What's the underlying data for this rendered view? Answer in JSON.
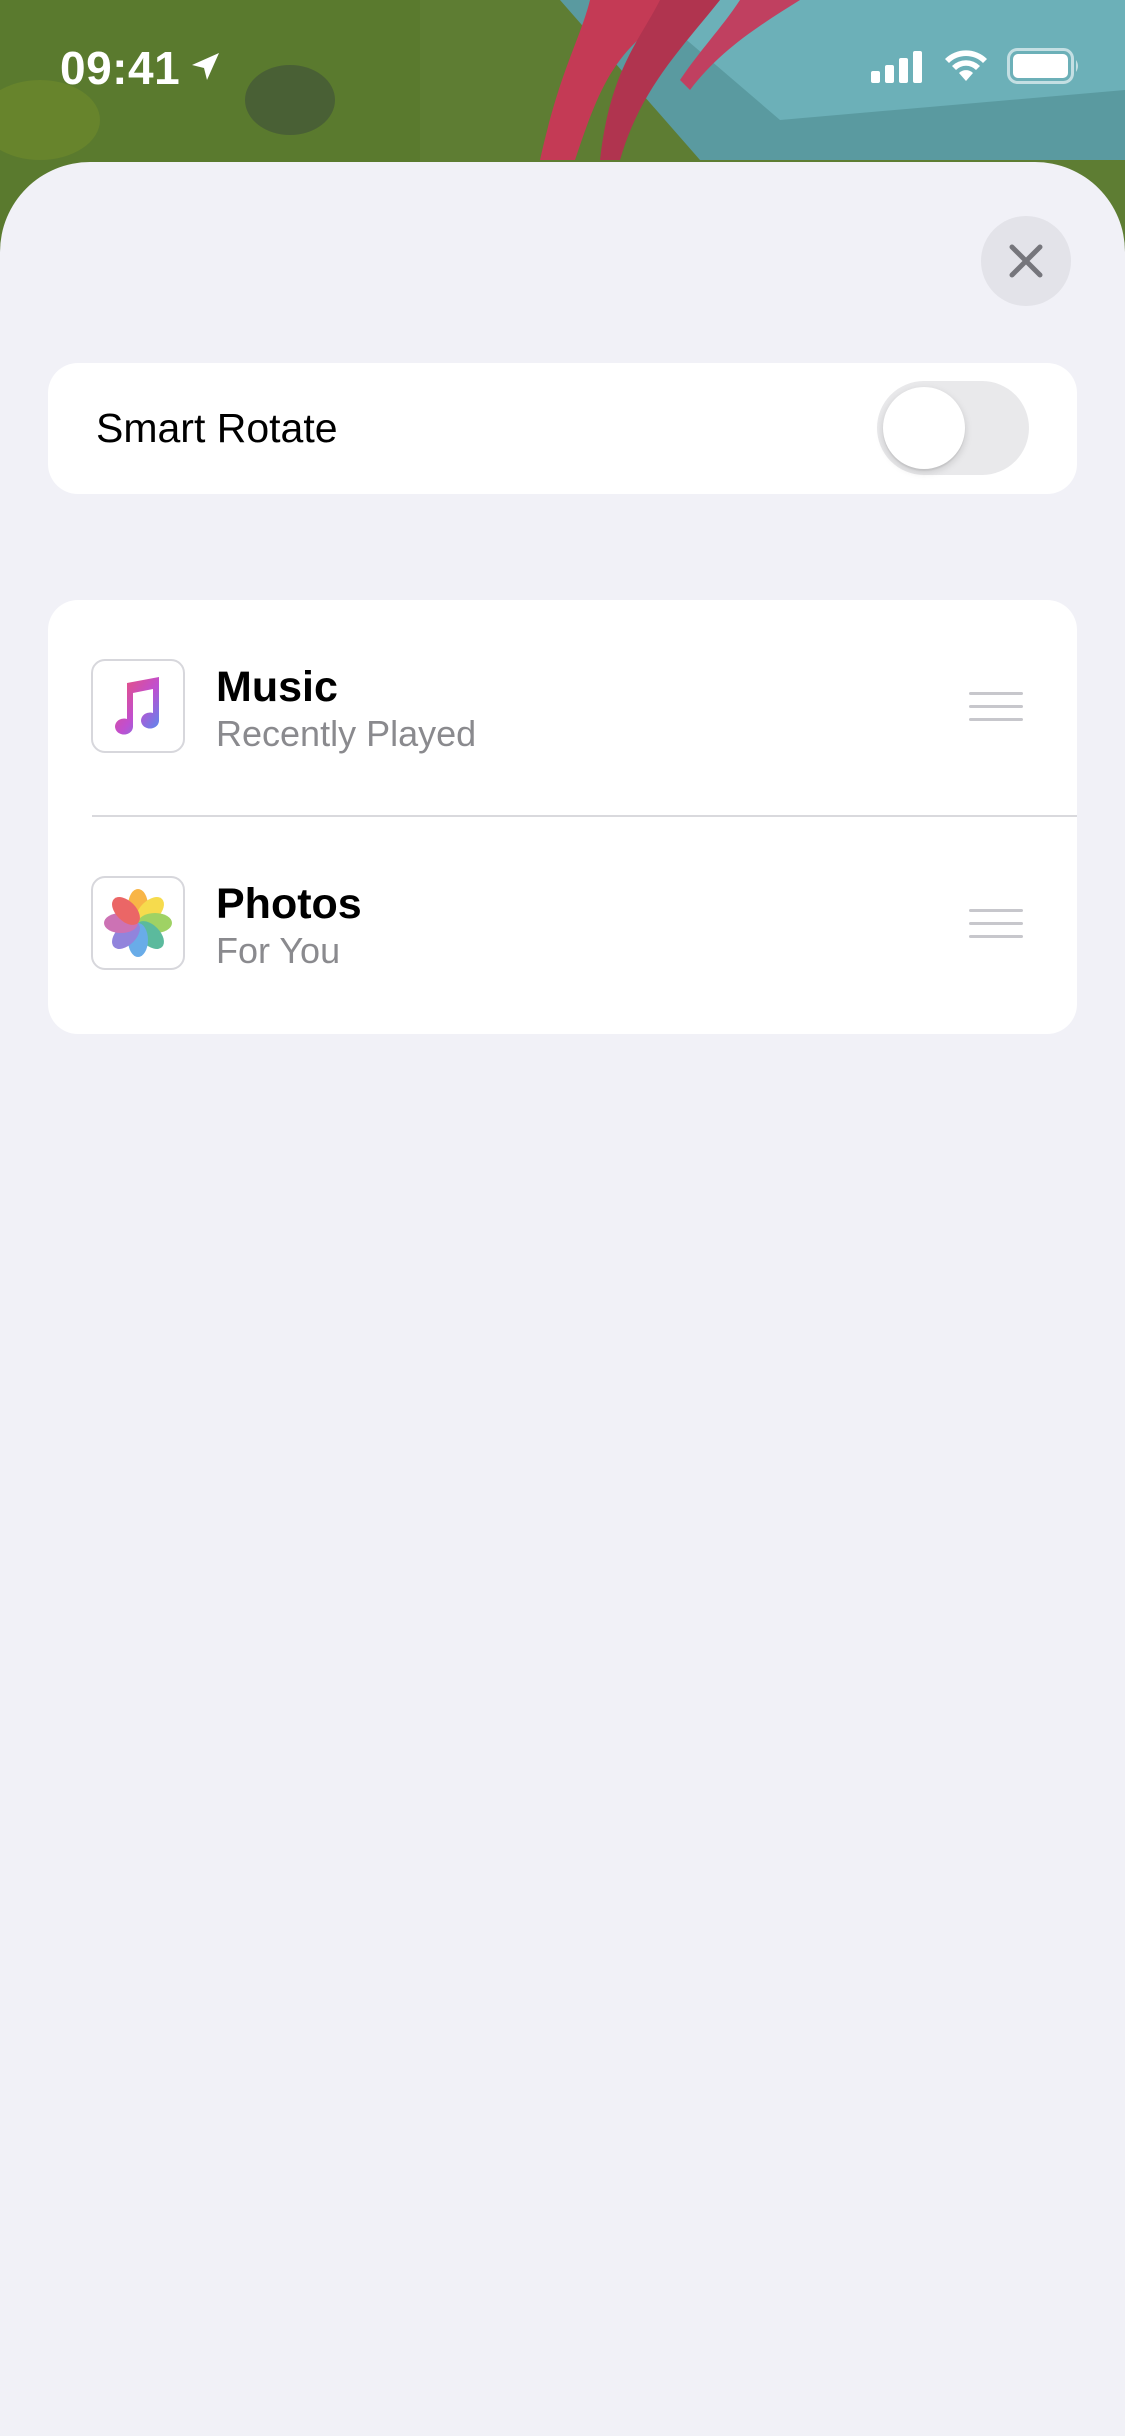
{
  "status_bar": {
    "time": "09:41",
    "icons": [
      "location-arrow-icon",
      "cellular-signal-icon",
      "wifi-icon",
      "battery-icon"
    ]
  },
  "sheet": {
    "close_icon": "close-icon"
  },
  "smart_rotate": {
    "label": "Smart Rotate",
    "enabled": false
  },
  "widgets": [
    {
      "app": "Music",
      "subtitle": "Recently Played",
      "icon": "music-app-icon"
    },
    {
      "app": "Photos",
      "subtitle": "For You",
      "icon": "photos-app-icon"
    }
  ],
  "colors": {
    "sheet_background": "#f1f1f7",
    "card_background": "#ffffff",
    "secondary_text": "#8a8a8e",
    "toggle_off": "#e9e9eb"
  }
}
